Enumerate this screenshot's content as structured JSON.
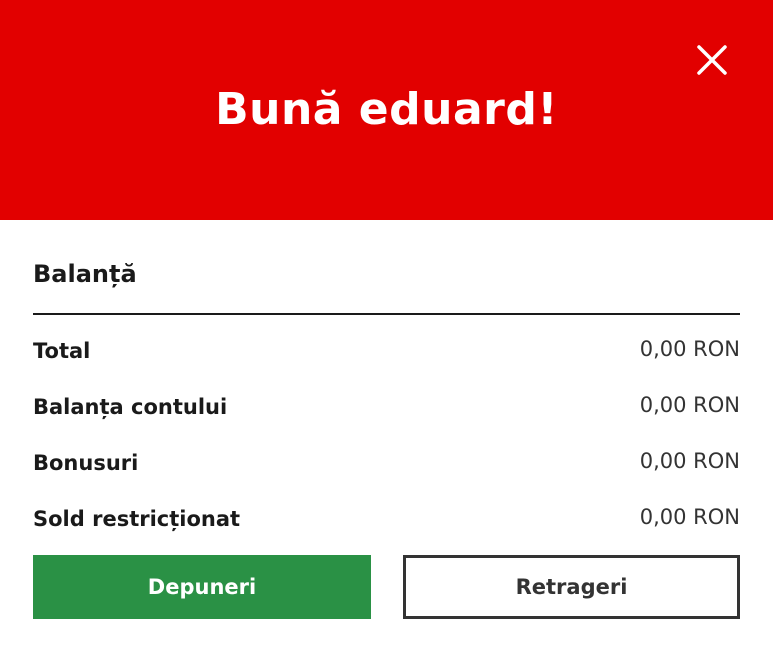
{
  "header": {
    "greeting": "Bună eduard!",
    "close_icon": "close-icon",
    "background_color": "#e20000"
  },
  "balance": {
    "title": "Balanță",
    "rows": [
      {
        "label": "Total",
        "value": "0,00 RON"
      },
      {
        "label": "Balanța contului",
        "value": "0,00 RON"
      },
      {
        "label": "Bonusuri",
        "value": "0,00 RON"
      },
      {
        "label": "Sold restricționat",
        "value": "0,00 RON"
      }
    ]
  },
  "actions": {
    "deposit_label": "Depuneri",
    "withdraw_label": "Retrageri",
    "deposit_color": "#2a9145"
  }
}
